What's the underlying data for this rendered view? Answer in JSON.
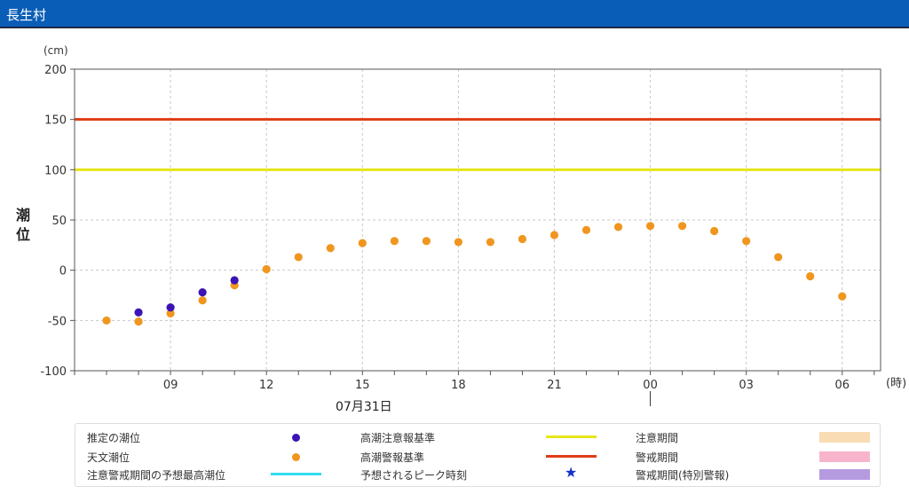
{
  "window": {
    "title": "長生村"
  },
  "chart_data": {
    "type": "scatter",
    "yunit": "(cm)",
    "xunit": "(時)",
    "ylabel_chars": [
      "潮",
      "位"
    ],
    "ylim": [
      -100,
      200
    ],
    "yticks": [
      200,
      150,
      100,
      50,
      0,
      -50,
      -100
    ],
    "date_label": "07月31日",
    "xticks": [
      {
        "h": 9,
        "label": "09"
      },
      {
        "h": 12,
        "label": "12"
      },
      {
        "h": 15,
        "label": "15"
      },
      {
        "h": 18,
        "label": "18"
      },
      {
        "h": 21,
        "label": "21"
      },
      {
        "h": 24,
        "label": "00"
      },
      {
        "h": 27,
        "label": "03"
      },
      {
        "h": 30,
        "label": "06"
      }
    ],
    "xlim": [
      6,
      31.2
    ],
    "day_boundary_h": 24,
    "grid": true,
    "thresholds": [
      {
        "name": "高潮警報基準",
        "value": 150,
        "color": "#e03c14"
      },
      {
        "name": "高潮注意報基準",
        "value": 100,
        "color": "#e6e619"
      }
    ],
    "series": [
      {
        "name": "推定の潮位",
        "color": "#3c14b4",
        "x": [
          8,
          9,
          10,
          11
        ],
        "y": [
          -42,
          -37,
          -22,
          -10
        ]
      },
      {
        "name": "天文潮位",
        "color": "#f0961e",
        "x": [
          7,
          8,
          9,
          10,
          11,
          12,
          13,
          14,
          15,
          16,
          17,
          18,
          19,
          20,
          21,
          22,
          23,
          24,
          25,
          26,
          27,
          28,
          29,
          30
        ],
        "y": [
          -50,
          -51,
          -43,
          -30,
          -15,
          1,
          13,
          22,
          27,
          29,
          29,
          28,
          28,
          31,
          35,
          40,
          43,
          44,
          44,
          39,
          29,
          13,
          -6,
          -26
        ]
      }
    ]
  },
  "legend": {
    "estimated": "推定の潮位",
    "astronomical": "天文潮位",
    "predicted_max": "注意警戒期間の予想最高潮位",
    "advisory_std": "高潮注意報基準",
    "warning_std": "高潮警報基準",
    "peak_time": "予想されるピーク時刻",
    "advisory_period": "注意期間",
    "warning_period": "警戒期間",
    "special_period": "警戒期間(特別警報)",
    "colors": {
      "estimated": "#3c14b4",
      "astronomical": "#f0961e",
      "predicted_max": "#32dcf0",
      "advisory_std": "#e6e619",
      "warning_std": "#e03c14",
      "peak_star": "#1432c8",
      "advisory_period": "#fadcb4",
      "warning_period": "#f8b4cc",
      "special_period": "#b49be0"
    }
  }
}
